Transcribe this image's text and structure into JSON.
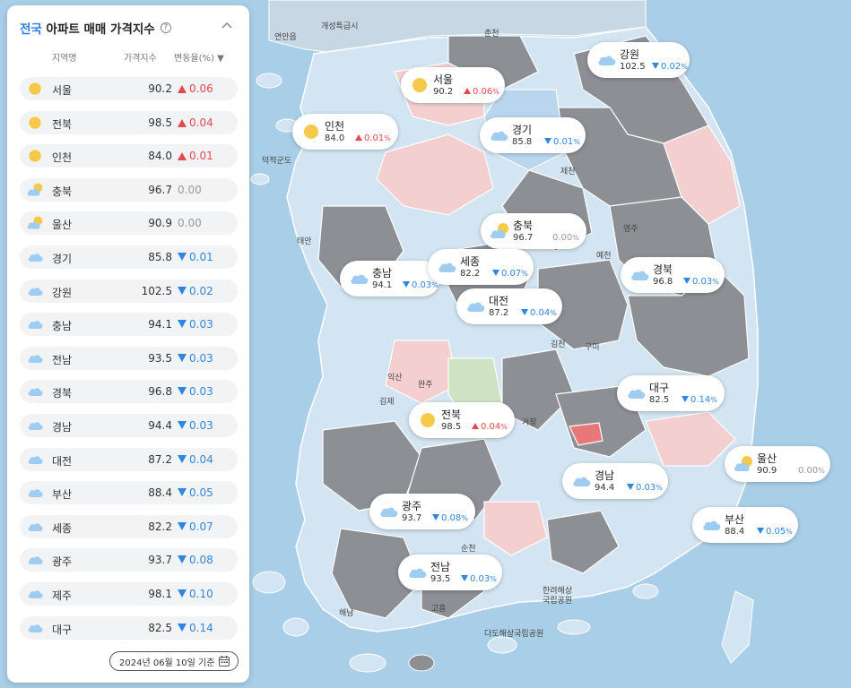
{
  "panel": {
    "title_accent": "전국",
    "title_rest": "아파트 매매 가격지수",
    "help": "?",
    "columns": {
      "region": "지역명",
      "index": "가격지수",
      "change": "변동율(%) ▼"
    },
    "rows": [
      {
        "name": "서울",
        "weather": "sun",
        "index": "90.2",
        "change": "0.06",
        "dir": "up"
      },
      {
        "name": "전북",
        "weather": "sun",
        "index": "98.5",
        "change": "0.04",
        "dir": "up"
      },
      {
        "name": "인천",
        "weather": "sun",
        "index": "84.0",
        "change": "0.01",
        "dir": "up"
      },
      {
        "name": "충북",
        "weather": "partly",
        "index": "96.7",
        "change": "0.00",
        "dir": "flat"
      },
      {
        "name": "울산",
        "weather": "partly",
        "index": "90.9",
        "change": "0.00",
        "dir": "flat"
      },
      {
        "name": "경기",
        "weather": "cloud",
        "index": "85.8",
        "change": "0.01",
        "dir": "down"
      },
      {
        "name": "강원",
        "weather": "cloud",
        "index": "102.5",
        "change": "0.02",
        "dir": "down"
      },
      {
        "name": "충남",
        "weather": "cloud",
        "index": "94.1",
        "change": "0.03",
        "dir": "down"
      },
      {
        "name": "전남",
        "weather": "cloud",
        "index": "93.5",
        "change": "0.03",
        "dir": "down"
      },
      {
        "name": "경북",
        "weather": "cloud",
        "index": "96.8",
        "change": "0.03",
        "dir": "down"
      },
      {
        "name": "경남",
        "weather": "cloud",
        "index": "94.4",
        "change": "0.03",
        "dir": "down"
      },
      {
        "name": "대전",
        "weather": "cloud",
        "index": "87.2",
        "change": "0.04",
        "dir": "down"
      },
      {
        "name": "부산",
        "weather": "cloud",
        "index": "88.4",
        "change": "0.05",
        "dir": "down"
      },
      {
        "name": "세종",
        "weather": "cloud",
        "index": "82.2",
        "change": "0.07",
        "dir": "down"
      },
      {
        "name": "광주",
        "weather": "cloud",
        "index": "93.7",
        "change": "0.08",
        "dir": "down"
      },
      {
        "name": "제주",
        "weather": "cloud",
        "index": "98.1",
        "change": "0.10",
        "dir": "down"
      },
      {
        "name": "대구",
        "weather": "cloud",
        "index": "82.5",
        "change": "0.14",
        "dir": "down"
      }
    ],
    "date_label": "2024년 06월 10일 기준"
  },
  "bubbles": [
    {
      "name": "서울",
      "index": "90.2",
      "change": "0.06",
      "dir": "up",
      "weather": "sun"
    },
    {
      "name": "강원",
      "index": "102.5",
      "change": "0.02",
      "dir": "down",
      "weather": "cloud"
    },
    {
      "name": "인천",
      "index": "84.0",
      "change": "0.01",
      "dir": "up",
      "weather": "sun"
    },
    {
      "name": "경기",
      "index": "85.8",
      "change": "0.01",
      "dir": "down",
      "weather": "cloud"
    },
    {
      "name": "충북",
      "index": "96.7",
      "change": "0.00",
      "dir": "flat",
      "weather": "partly"
    },
    {
      "name": "충남",
      "index": "94.1",
      "change": "0.03",
      "dir": "down",
      "weather": "cloud"
    },
    {
      "name": "세종",
      "index": "82.2",
      "change": "0.07",
      "dir": "down",
      "weather": "cloud"
    },
    {
      "name": "경북",
      "index": "96.8",
      "change": "0.03",
      "dir": "down",
      "weather": "cloud"
    },
    {
      "name": "대전",
      "index": "87.2",
      "change": "0.04",
      "dir": "down",
      "weather": "cloud"
    },
    {
      "name": "대구",
      "index": "82.5",
      "change": "0.14",
      "dir": "down",
      "weather": "cloud"
    },
    {
      "name": "전북",
      "index": "98.5",
      "change": "0.04",
      "dir": "up",
      "weather": "sun"
    },
    {
      "name": "울산",
      "index": "90.9",
      "change": "0.00",
      "dir": "flat",
      "weather": "partly"
    },
    {
      "name": "경남",
      "index": "94.4",
      "change": "0.03",
      "dir": "down",
      "weather": "cloud"
    },
    {
      "name": "광주",
      "index": "93.7",
      "change": "0.08",
      "dir": "down",
      "weather": "cloud"
    },
    {
      "name": "부산",
      "index": "88.4",
      "change": "0.05",
      "dir": "down",
      "weather": "cloud"
    },
    {
      "name": "전남",
      "index": "93.5",
      "change": "0.03",
      "dir": "down",
      "weather": "cloud"
    }
  ],
  "map_labels": {
    "l1": "개성특급시",
    "l2": "연안읍",
    "l3": "덕적군도",
    "l4": "태안",
    "l5": "춘천",
    "l6": "제천",
    "l7": "영주",
    "l8": "예천",
    "l9": "구미",
    "l10": "김천",
    "l11": "익산",
    "l12": "김제",
    "l13": "완주",
    "l14": "거창",
    "l15": "순천",
    "l16": "고흥",
    "l17": "해남",
    "l18": "다도해상국립공원",
    "l19": "한려해상국립공원"
  },
  "colors": {
    "accent": "#2d7be5",
    "up": "#e5484d",
    "down": "#2f86e0",
    "flat": "#999999",
    "sea": "#a9cfe8",
    "land": "#d3e5f2",
    "gray_region": "#8c8f94",
    "pink_region": "#f4cfcf"
  },
  "icons": {
    "sun": "sun-icon",
    "cloud": "cloud-icon",
    "partly": "partly-cloudy-icon",
    "help": "help-circle-icon",
    "collapse": "chevron-up-icon",
    "calendar": "calendar-icon"
  }
}
